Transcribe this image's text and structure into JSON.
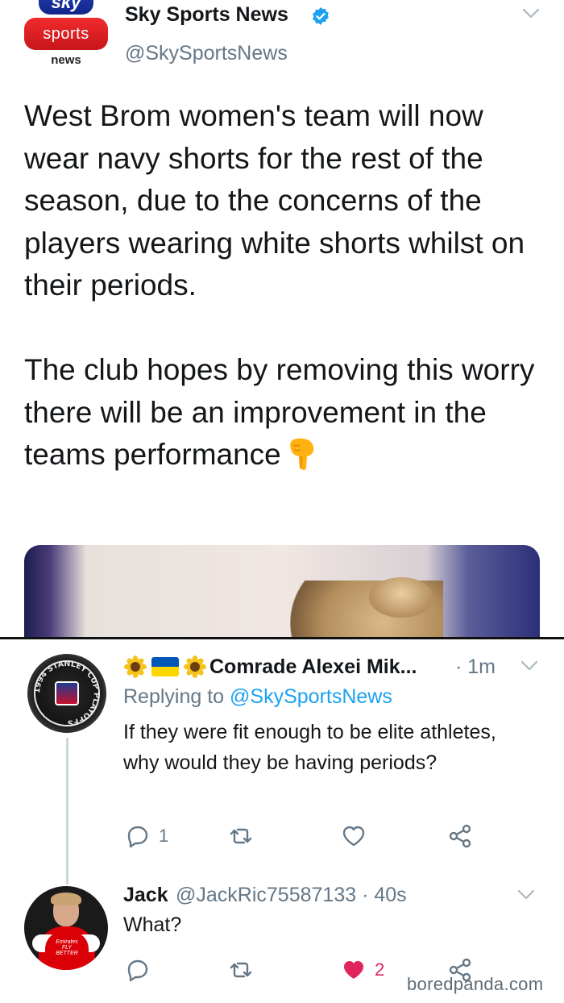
{
  "colors": {
    "text": "#14171a",
    "muted": "#657786",
    "link": "#1da1f2",
    "like": "#e0245e",
    "divider": "#111111"
  },
  "tweet": {
    "logo": {
      "top": "sky",
      "middle": "sports",
      "bottom": "news"
    },
    "name": "Sky Sports News",
    "handle": "@SkySportsNews",
    "verified_icon": "verified-badge-icon",
    "text": "West Brom women's team will now wear navy shorts for the rest of the season, due to the concerns of the players wearing white shorts whilst on their periods.\n\nThe club hopes by removing this worry there will be an improvement in the teams performance",
    "emoji_icon": "backhand-index-pointing-down-icon"
  },
  "reply1": {
    "name": "Comrade Alexei Mik...",
    "time": "· 1m",
    "replying_prefix": "Replying to ",
    "replying_to": "@SkySportsNews",
    "text": "If they were fit enough to be elite athletes, why would they be having periods?",
    "avatar_text": "1994 STANLEY CUP PLAYOFFS",
    "actions": {
      "reply_count": "1",
      "retweet_count": "",
      "like_count": ""
    }
  },
  "reply2": {
    "name": "Jack",
    "meta": "@JackRic75587133 · 40s",
    "text": "What?",
    "avatar_text": "Emirates FLY BETTER",
    "actions": {
      "reply_count": "",
      "retweet_count": "",
      "like_count": "2"
    }
  },
  "watermark": "boredpanda.com"
}
